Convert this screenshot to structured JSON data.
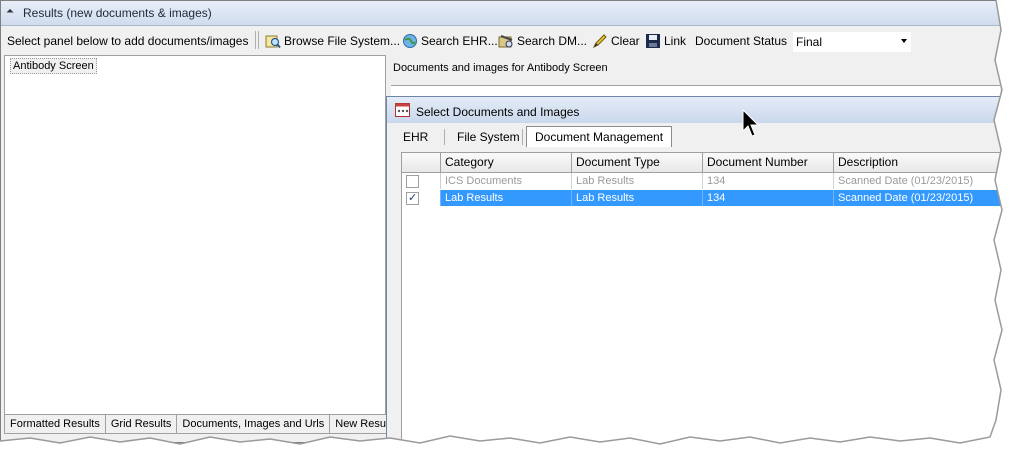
{
  "window": {
    "title": "Results (new documents & images)"
  },
  "toolbar": {
    "prompt": "Select panel below to add documents/images",
    "browse": "Browse File System...",
    "search_ehr": "Search EHR...",
    "search_dm": "Search DM...",
    "clear": "Clear",
    "link": "Link",
    "doc_status_label": "Document Status",
    "doc_status_value": "Final"
  },
  "left_panel": {
    "items": [
      "Antibody Screen"
    ]
  },
  "bottom_tabs": [
    "Formatted Results",
    "Grid Results",
    "Documents, Images and Urls",
    "New Results"
  ],
  "right_panel": {
    "label": "Documents and images for Antibody Screen"
  },
  "dialog": {
    "title": "Select Documents and Images",
    "tabs": [
      "EHR",
      "File System",
      "Document Management"
    ],
    "active_tab": "Document Management",
    "columns": [
      "Category",
      "Document Type",
      "Document Number",
      "Description"
    ],
    "rows": [
      {
        "checked": false,
        "selected": false,
        "category": "ICS Documents",
        "document_type": "Lab Results",
        "document_number": "134",
        "description": "Scanned Date (01/23/2015)"
      },
      {
        "checked": true,
        "selected": true,
        "category": "Lab Results",
        "document_type": "Lab Results",
        "document_number": "134",
        "description": "Scanned Date (01/23/2015)"
      }
    ]
  },
  "colors": {
    "selection": "#3399ff",
    "titlebar": "#cfdcee",
    "background": "#f0f0f0"
  }
}
